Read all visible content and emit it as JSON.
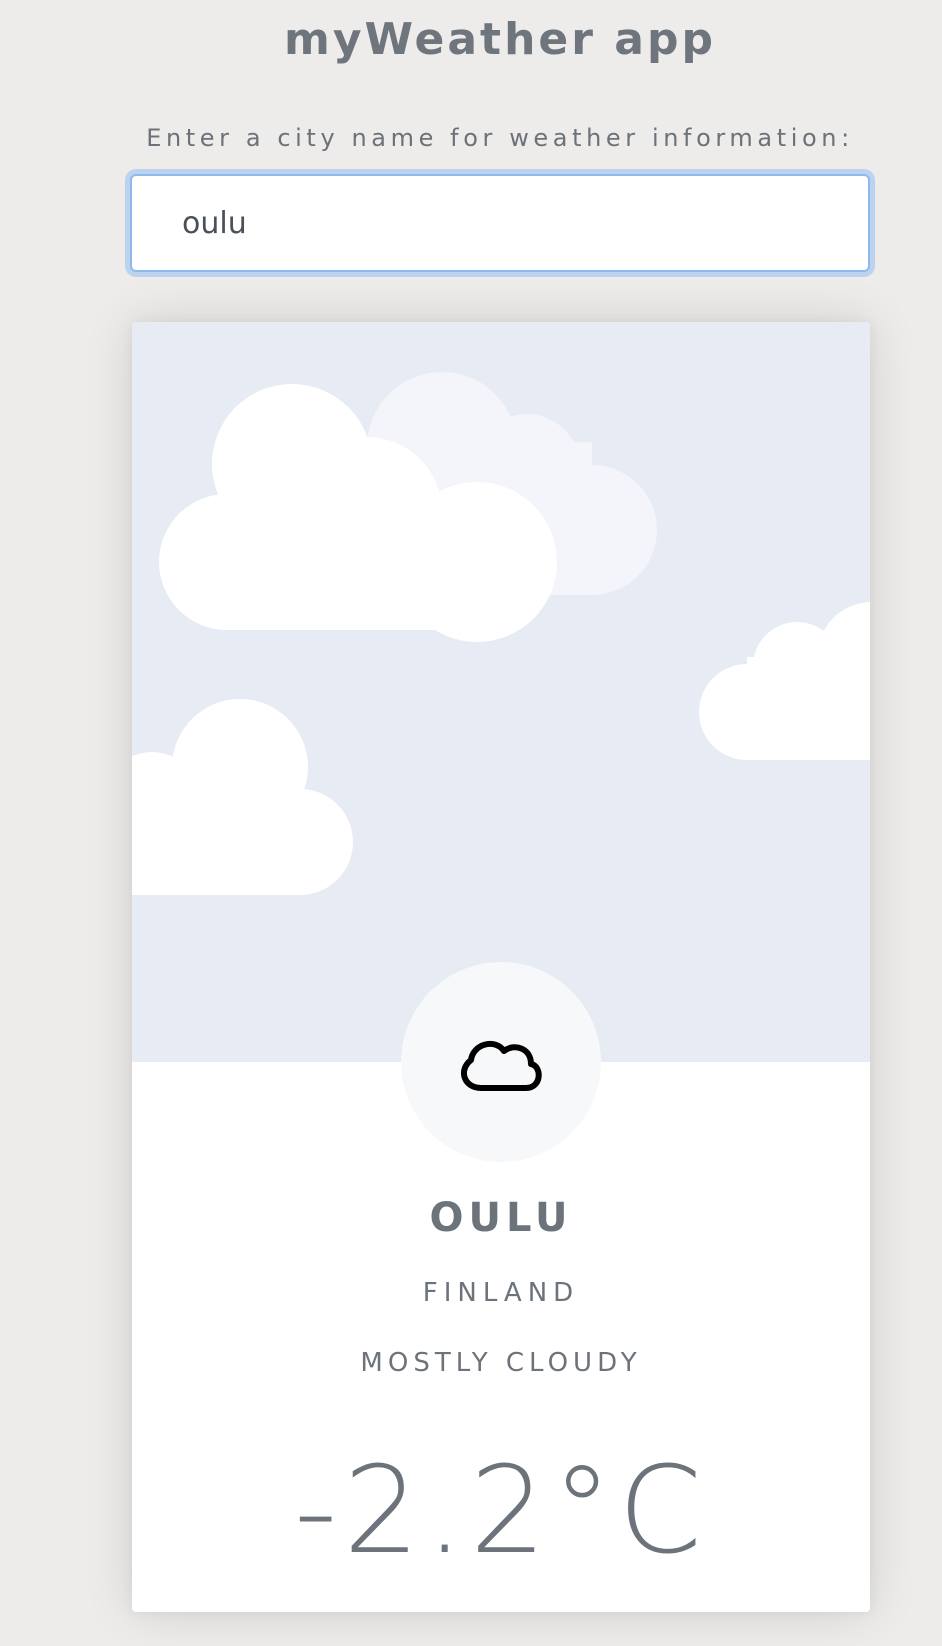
{
  "app": {
    "title": "myWeather app"
  },
  "search": {
    "label": "Enter a city name for weather information:",
    "value": "oulu",
    "placeholder": ""
  },
  "weather": {
    "city": "OULU",
    "country": "FINLAND",
    "condition": "MOSTLY CLOUDY",
    "temperature": "-2.2°C",
    "icon": "cloud-icon"
  },
  "colors": {
    "page_background": "#eeecea",
    "sky_background": "#e6ebf4",
    "text": "#6c757d",
    "input_focus_border": "#8db9ec"
  }
}
